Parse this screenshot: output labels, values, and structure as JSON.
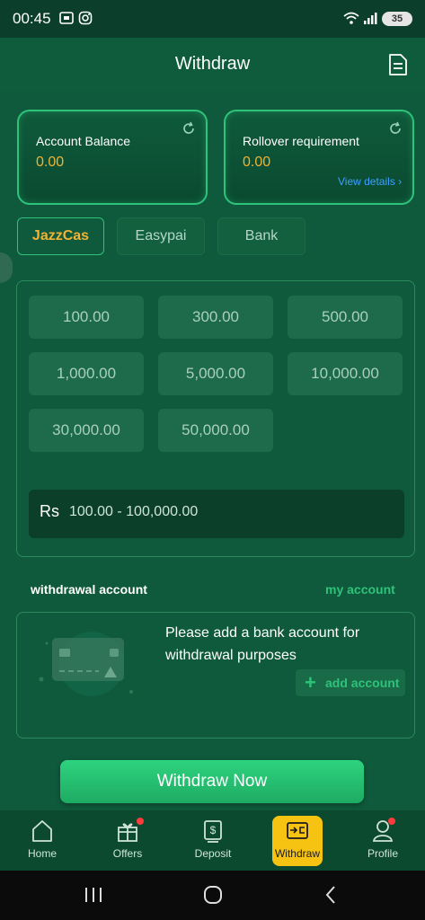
{
  "status_bar": {
    "time": "00:45",
    "battery": "35"
  },
  "header": {
    "title": "Withdraw",
    "icon": "document-icon"
  },
  "balance_cards": [
    {
      "label": "Account Balance",
      "value": "0.00"
    },
    {
      "label": "Rollover requirement",
      "value": "0.00",
      "link": "View details"
    }
  ],
  "tabs": [
    {
      "label": "JazzCas",
      "active": true
    },
    {
      "label": "Easypai",
      "active": false
    },
    {
      "label": "Bank",
      "active": false
    }
  ],
  "amounts": [
    "100.00",
    "300.00",
    "500.00",
    "1,000.00",
    "5,000.00",
    "10,000.00",
    "30,000.00",
    "50,000.00"
  ],
  "amount_input": {
    "currency": "Rs",
    "placeholder": "100.00 - 100,000.00"
  },
  "withdrawal_account": {
    "title": "withdrawal account",
    "my_account": "my account",
    "message": "Please add a bank account for withdrawal purposes",
    "add_label": "add account"
  },
  "withdraw_button": "Withdraw Now",
  "bottom_nav": [
    {
      "label": "Home",
      "icon": "home-icon",
      "active": false
    },
    {
      "label": "Offers",
      "icon": "gift-icon",
      "active": false,
      "badge": true
    },
    {
      "label": "Deposit",
      "icon": "deposit-icon",
      "active": false
    },
    {
      "label": "Withdraw",
      "icon": "withdraw-icon",
      "active": true
    },
    {
      "label": "Profile",
      "icon": "profile-icon",
      "active": false,
      "badge": true
    }
  ],
  "colors": {
    "accent": "#2ec27a",
    "value": "#f2b233",
    "active_nav": "#f6c313",
    "link": "#3ea1ff"
  }
}
